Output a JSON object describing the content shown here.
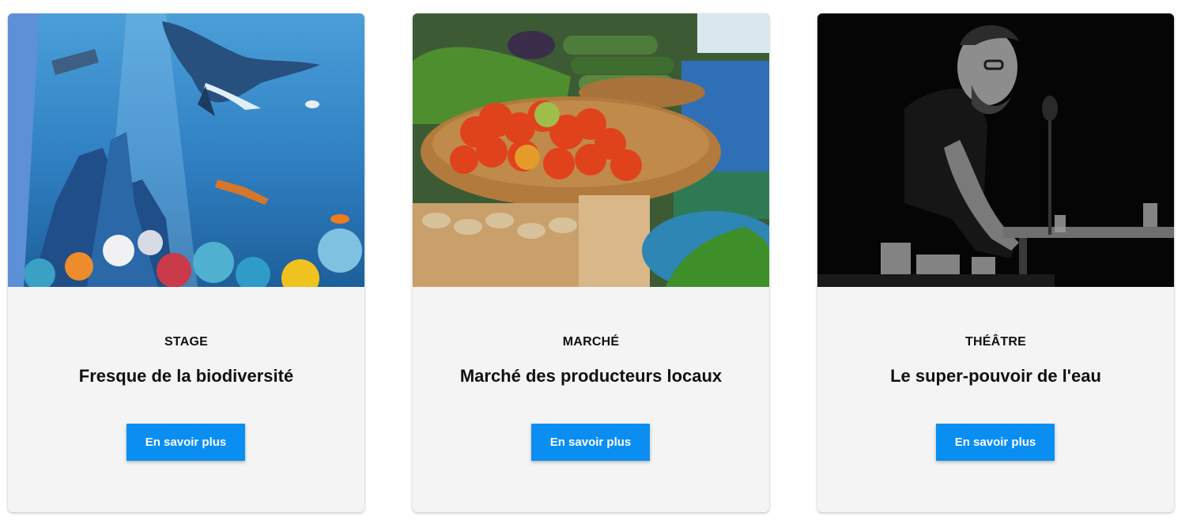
{
  "cards": [
    {
      "category": "STAGE",
      "title": "Fresque de la biodiversité",
      "button_label": "En savoir plus"
    },
    {
      "category": "MARCHÉ",
      "title": "Marché des producteurs locaux",
      "button_label": "En savoir plus"
    },
    {
      "category": "THÉÂTRE",
      "title": "Le super-pouvoir de l'eau",
      "button_label": "En savoir plus"
    }
  ],
  "colors": {
    "button_background": "#0a8ef2",
    "card_background": "#f4f4f4"
  }
}
